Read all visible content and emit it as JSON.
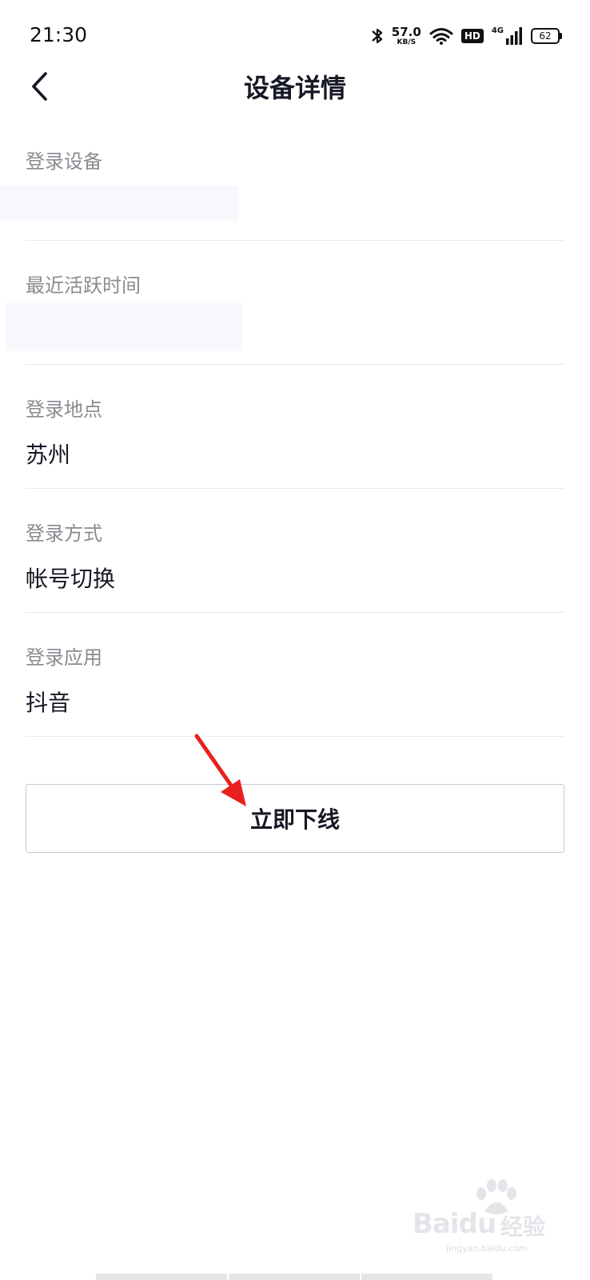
{
  "status_bar": {
    "time": "21:30",
    "net_speed_value": "57.0",
    "net_speed_unit": "KB/S",
    "hd_badge": "HD",
    "network_type": "4G",
    "battery_level": "62",
    "icons": [
      "bluetooth-icon",
      "wifi-icon",
      "signal-icon",
      "battery-icon"
    ]
  },
  "nav": {
    "back_icon": "chevron-left-icon",
    "title": "设备详情"
  },
  "details": [
    {
      "label": "登录设备",
      "value": ""
    },
    {
      "label": "最近活跃时间",
      "value": ""
    },
    {
      "label": "登录地点",
      "value": "苏州"
    },
    {
      "label": "登录方式",
      "value": "帐号切换"
    },
    {
      "label": "登录应用",
      "value": "抖音"
    }
  ],
  "actions": {
    "offline_label": "立即下线"
  },
  "annotation": {
    "arrow_color": "#e8201f"
  },
  "watermark": {
    "brand": "Baidu",
    "cn": "经验",
    "url": "jingyan.baidu.com"
  },
  "colors": {
    "text_primary": "#161823",
    "text_secondary": "#8a8b91",
    "divider": "#e8e8ea"
  }
}
